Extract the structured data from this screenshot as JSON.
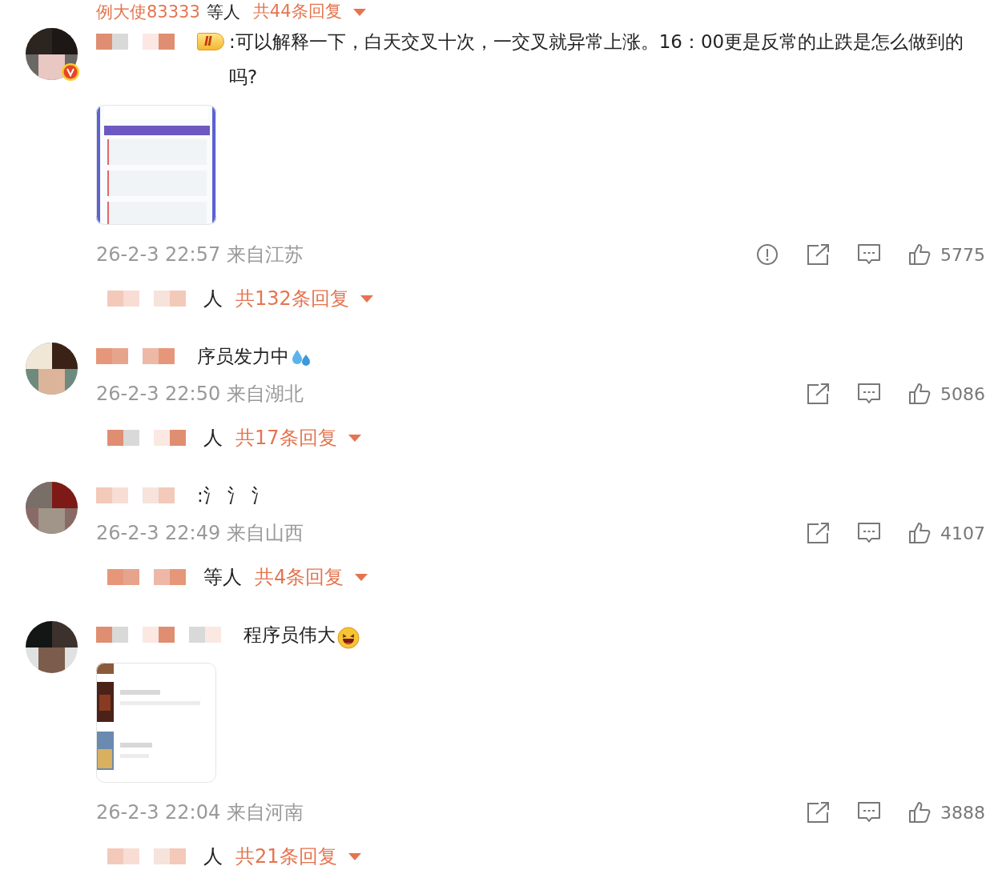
{
  "top_replies": {
    "names": "例大使83333",
    "suffix": "等人",
    "count_label": "共44条回复"
  },
  "comments": [
    {
      "verified": true,
      "badge": "Ⅱ",
      "text": ":可以解释一下，白天交叉十次，一交叉就异常上涨。16：00更是反常的止跌是怎么做到的吗?",
      "attachment": {
        "kind": "picture"
      },
      "meta": "26-2-3 22:57 来自江苏",
      "actions": [
        {
          "kind": "report"
        },
        {
          "kind": "share"
        },
        {
          "kind": "comment"
        },
        {
          "kind": "like",
          "count": "5775"
        }
      ],
      "replies": {
        "suffix": "人",
        "count_label": "共132条回复"
      }
    },
    {
      "verified": false,
      "text": "序员发力中",
      "meta": "26-2-3 22:50 来自湖北",
      "actions": [
        {
          "kind": "share"
        },
        {
          "kind": "comment"
        },
        {
          "kind": "like",
          "count": "5086"
        }
      ],
      "replies": {
        "suffix": "人",
        "count_label": "共17条回复"
      }
    },
    {
      "verified": false,
      "text": ":氵 氵 氵",
      "meta": "26-2-3 22:49 来自山西",
      "actions": [
        {
          "kind": "share"
        },
        {
          "kind": "comment"
        },
        {
          "kind": "like",
          "count": "4107"
        }
      ],
      "replies": {
        "suffix": "等人",
        "count_label": "共4条回复"
      }
    },
    {
      "verified": false,
      "text": "程序员伟大",
      "attachment": {
        "kind": "picture"
      },
      "meta": "26-2-3 22:04 来自河南",
      "actions": [
        {
          "kind": "share"
        },
        {
          "kind": "comment"
        },
        {
          "kind": "like",
          "count": "3888"
        }
      ],
      "replies": {
        "suffix": "人",
        "count_label": "共21条回复"
      }
    }
  ]
}
